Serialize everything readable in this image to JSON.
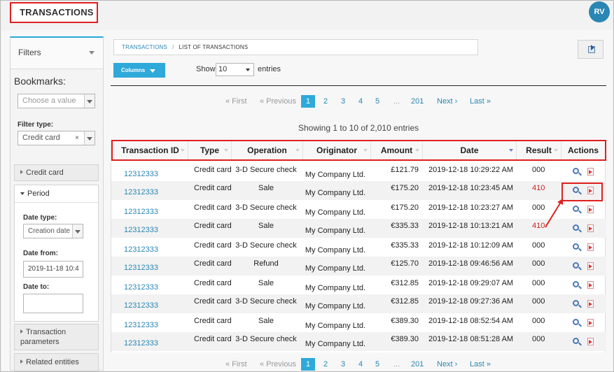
{
  "header": {
    "title": "TRANSACTIONS",
    "avatar_initials": "RV"
  },
  "sidebar": {
    "filters_label": "Filters",
    "bookmarks_label": "Bookmarks:",
    "bookmarks_placeholder": "Choose a value",
    "filter_type_label": "Filter type:",
    "filter_type_value": "Credit card",
    "filter_clear": "×",
    "sections": {
      "credit_card": "Credit card",
      "period": "Period",
      "transaction_parameters_1": "Transaction",
      "transaction_parameters_2": "parameters",
      "related_entities": "Related entities"
    },
    "period": {
      "date_type_label": "Date type:",
      "date_type_value": "Creation date",
      "date_from_label": "Date from:",
      "date_from_value": "2019-11-18 10:4",
      "date_to_label": "Date to:",
      "date_to_value": ""
    }
  },
  "breadcrumb": {
    "root": "TRANSACTIONS",
    "separator": "/",
    "current": "LIST OF TRANSACTIONS"
  },
  "toolbar": {
    "columns_label": "Columns",
    "show_label": "Show",
    "page_size": "10",
    "entries_label": "entries"
  },
  "pagination": {
    "first": "« First",
    "previous": "« Previous",
    "pages": [
      "1",
      "2",
      "3",
      "4",
      "5"
    ],
    "ellipsis": "...",
    "last_page": "201",
    "next": "Next ›",
    "last": "Last »"
  },
  "info": "Showing 1 to 10 of 2,010 entries",
  "table": {
    "headers": [
      "Transaction ID",
      "Type",
      "Operation",
      "Originator",
      "Amount",
      "Date",
      "Result",
      "Actions"
    ],
    "rows": [
      {
        "id": "12312333",
        "type": "Credit card",
        "operation": "3-D Secure check",
        "originator": "My Company Ltd.",
        "amount": "£121.79",
        "date": "2019-12-18 10:29:22 AM",
        "result": "000"
      },
      {
        "id": "12312333",
        "type": "Credit card",
        "operation": "Sale",
        "originator": "My Company Ltd.",
        "amount": "€175.20",
        "date": "2019-12-18 10:23:45 AM",
        "result": "410"
      },
      {
        "id": "12312333",
        "type": "Credit card",
        "operation": "3-D Secure check",
        "originator": "My Company Ltd.",
        "amount": "€175.20",
        "date": "2019-12-18 10:23:27 AM",
        "result": "000"
      },
      {
        "id": "12312333",
        "type": "Credit card",
        "operation": "Sale",
        "originator": "My Company Ltd.",
        "amount": "€335.33",
        "date": "2019-12-18 10:13:21 AM",
        "result": "410"
      },
      {
        "id": "12312333",
        "type": "Credit card",
        "operation": "3-D Secure check",
        "originator": "My Company Ltd.",
        "amount": "€335.33",
        "date": "2019-12-18 10:12:09 AM",
        "result": "000"
      },
      {
        "id": "12312333",
        "type": "Credit card",
        "operation": "Refund",
        "originator": "My Company Ltd.",
        "amount": "€125.70",
        "date": "2019-12-18 09:46:56 AM",
        "result": "000"
      },
      {
        "id": "12312333",
        "type": "Credit card",
        "operation": "Sale",
        "originator": "My Company Ltd.",
        "amount": "€312.85",
        "date": "2019-12-18 09:29:07 AM",
        "result": "000"
      },
      {
        "id": "12312333",
        "type": "Credit card",
        "operation": "3-D Secure check",
        "originator": "My Company Ltd.",
        "amount": "€312.85",
        "date": "2019-12-18 09:27:36 AM",
        "result": "000"
      },
      {
        "id": "12312333",
        "type": "Credit card",
        "operation": "Sale",
        "originator": "My Company Ltd.",
        "amount": "€389.30",
        "date": "2019-12-18 08:52:54 AM",
        "result": "000"
      },
      {
        "id": "12312333",
        "type": "Credit card",
        "operation": "3-D Secure check",
        "originator": "My Company Ltd.",
        "amount": "€389.30",
        "date": "2019-12-18 08:51:28 AM",
        "result": "000"
      }
    ]
  },
  "colors": {
    "accent": "#2ea9da",
    "link": "#2a86b4",
    "highlight": "#e02020",
    "error": "#cc2222"
  },
  "icons": {
    "view": "magnifier-icon",
    "pdf": "pdf-icon",
    "export": "export-icon"
  }
}
